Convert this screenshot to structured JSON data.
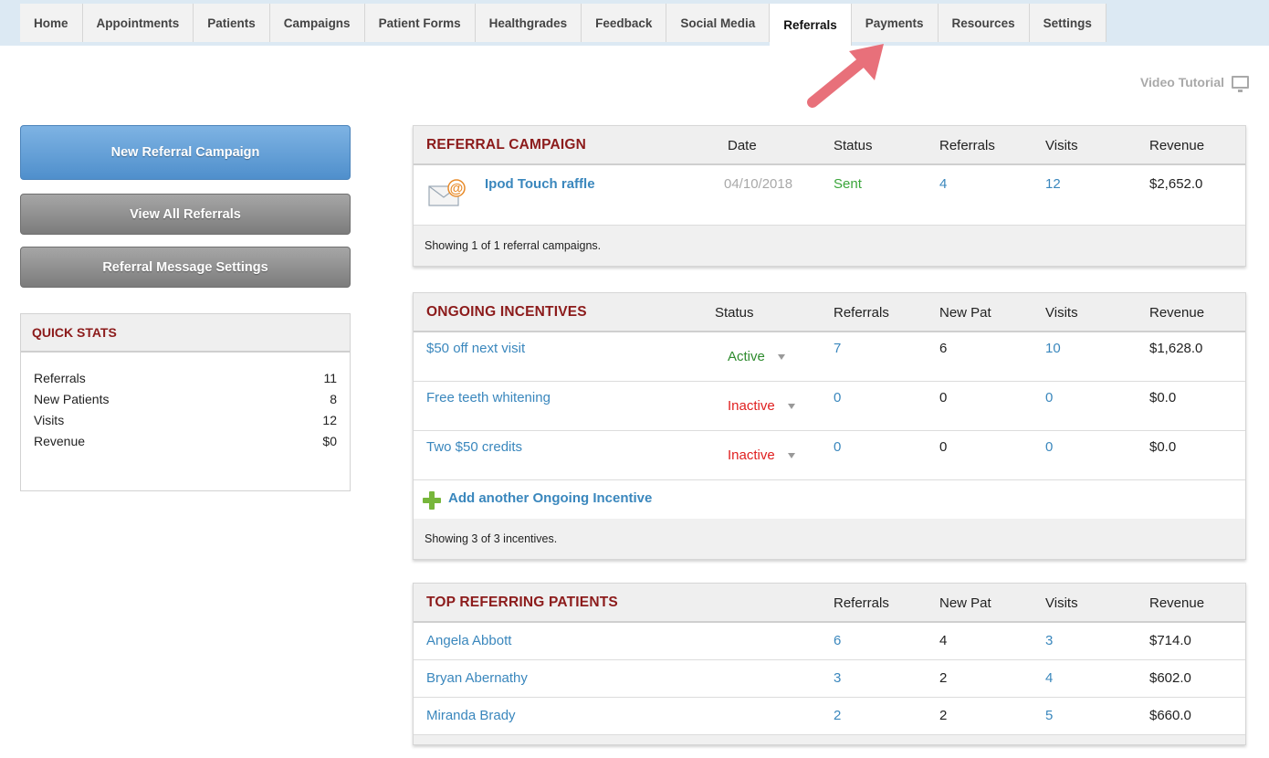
{
  "nav": {
    "tabs": [
      {
        "label": "Home"
      },
      {
        "label": "Appointments"
      },
      {
        "label": "Patients"
      },
      {
        "label": "Campaigns"
      },
      {
        "label": "Patient Forms"
      },
      {
        "label": "Healthgrades"
      },
      {
        "label": "Feedback"
      },
      {
        "label": "Social Media"
      },
      {
        "label": "Referrals"
      },
      {
        "label": "Payments"
      },
      {
        "label": "Resources"
      },
      {
        "label": "Settings"
      }
    ],
    "active": "Referrals"
  },
  "video_tutorial": "Video Tutorial",
  "buttons": {
    "new_campaign": "New Referral Campaign",
    "view_all": "View All Referrals",
    "message_settings": "Referral Message Settings"
  },
  "quick_stats": {
    "title": "QUICK STATS",
    "rows": [
      {
        "label": "Referrals",
        "value": "11"
      },
      {
        "label": "New Patients",
        "value": "8"
      },
      {
        "label": "Visits",
        "value": "12"
      },
      {
        "label": "Revenue",
        "value": "$0"
      }
    ]
  },
  "campaign_panel": {
    "title": "REFERRAL CAMPAIGN",
    "headers": {
      "date": "Date",
      "status": "Status",
      "referrals": "Referrals",
      "visits": "Visits",
      "revenue": "Revenue"
    },
    "rows": [
      {
        "name": "Ipod Touch raffle",
        "date": "04/10/2018",
        "status": "Sent",
        "referrals": "4",
        "visits": "12",
        "revenue": "$2,652.0"
      }
    ],
    "footer": "Showing 1 of 1 referral campaigns."
  },
  "incentives_panel": {
    "title": "ONGOING INCENTIVES",
    "headers": {
      "status": "Status",
      "referrals": "Referrals",
      "new_pat": "New Pat",
      "visits": "Visits",
      "revenue": "Revenue"
    },
    "rows": [
      {
        "name": "$50 off next visit",
        "status": "Active",
        "referrals": "7",
        "new_pat": "6",
        "visits": "10",
        "revenue": "$1,628.0"
      },
      {
        "name": "Free teeth whitening",
        "status": "Inactive",
        "referrals": "0",
        "new_pat": "0",
        "visits": "0",
        "revenue": "$0.0"
      },
      {
        "name": "Two $50 credits",
        "status": "Inactive",
        "referrals": "0",
        "new_pat": "0",
        "visits": "0",
        "revenue": "$0.0"
      }
    ],
    "add_label": "Add another Ongoing Incentive",
    "footer": "Showing 3 of 3 incentives."
  },
  "patients_panel": {
    "title": "TOP REFERRING PATIENTS",
    "headers": {
      "referrals": "Referrals",
      "new_pat": "New Pat",
      "visits": "Visits",
      "revenue": "Revenue"
    },
    "rows": [
      {
        "name": "Angela Abbott",
        "referrals": "6",
        "new_pat": "4",
        "visits": "3",
        "revenue": "$714.0"
      },
      {
        "name": "Bryan Abernathy",
        "referrals": "3",
        "new_pat": "2",
        "visits": "4",
        "revenue": "$602.0"
      },
      {
        "name": "Miranda Brady",
        "referrals": "2",
        "new_pat": "2",
        "visits": "5",
        "revenue": "$660.0"
      }
    ]
  },
  "colors": {
    "section_title": "#8c1b1b",
    "link": "#3a87bd",
    "status_active": "#2e8b2e",
    "status_inactive": "#e02020",
    "status_sent": "#3aa53a",
    "arrow": "#e8707a"
  }
}
